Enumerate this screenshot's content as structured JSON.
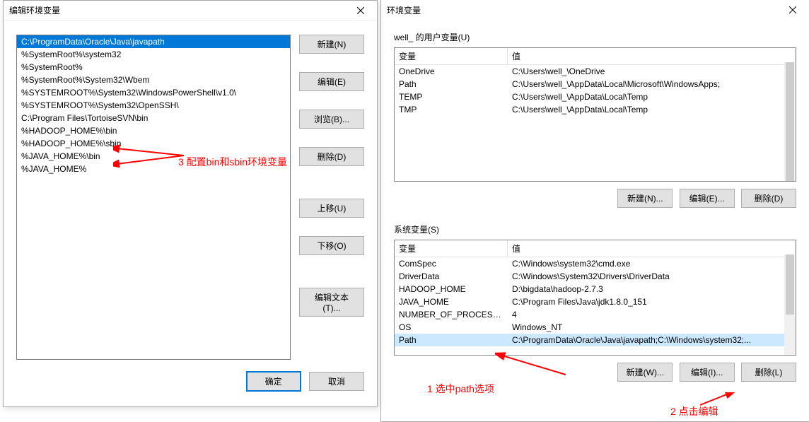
{
  "leftDialog": {
    "title": "编辑环境变量",
    "items": [
      "C:\\ProgramData\\Oracle\\Java\\javapath",
      "%SystemRoot%\\system32",
      "%SystemRoot%",
      "%SystemRoot%\\System32\\Wbem",
      "%SYSTEMROOT%\\System32\\WindowsPowerShell\\v1.0\\",
      "%SYSTEMROOT%\\System32\\OpenSSH\\",
      "C:\\Program Files\\TortoiseSVN\\bin",
      "%HADOOP_HOME%\\bin",
      "%HADOOP_HOME%\\sbin",
      "%JAVA_HOME%\\bin",
      "%JAVA_HOME%"
    ],
    "buttons": {
      "new": "新建(N)",
      "edit": "编辑(E)",
      "browse": "浏览(B)...",
      "delete": "删除(D)",
      "moveUp": "上移(U)",
      "moveDown": "下移(O)",
      "editText": "编辑文本(T)...",
      "ok": "确定",
      "cancel": "取消"
    }
  },
  "rightDialog": {
    "title": "环境变量",
    "userSection": "well_ 的用户变量(U)",
    "sysSection": "系统变量(S)",
    "headers": {
      "var": "变量",
      "val": "值"
    },
    "userVars": [
      {
        "name": "OneDrive",
        "value": "C:\\Users\\well_\\OneDrive"
      },
      {
        "name": "Path",
        "value": "C:\\Users\\well_\\AppData\\Local\\Microsoft\\WindowsApps;"
      },
      {
        "name": "TEMP",
        "value": "C:\\Users\\well_\\AppData\\Local\\Temp"
      },
      {
        "name": "TMP",
        "value": "C:\\Users\\well_\\AppData\\Local\\Temp"
      }
    ],
    "sysVars": [
      {
        "name": "ComSpec",
        "value": "C:\\Windows\\system32\\cmd.exe"
      },
      {
        "name": "DriverData",
        "value": "C:\\Windows\\System32\\Drivers\\DriverData"
      },
      {
        "name": "HADOOP_HOME",
        "value": "D:\\bigdata\\hadoop-2.7.3"
      },
      {
        "name": "JAVA_HOME",
        "value": "C:\\Program Files\\Java\\jdk1.8.0_151"
      },
      {
        "name": "NUMBER_OF_PROCESSORS",
        "value": "4"
      },
      {
        "name": "OS",
        "value": "Windows_NT"
      },
      {
        "name": "Path",
        "value": "C:\\ProgramData\\Oracle\\Java\\javapath;C:\\Windows\\system32;..."
      }
    ],
    "buttons": {
      "userNew": "新建(N)...",
      "userEdit": "编辑(E)...",
      "userDelete": "删除(D)",
      "sysNew": "新建(W)...",
      "sysEdit": "编辑(I)...",
      "sysDelete": "删除(L)"
    }
  },
  "annotations": {
    "a1": "1 选中path选项",
    "a2": "2 点击编辑",
    "a3": "3 配置bin和sbin环境变量"
  }
}
